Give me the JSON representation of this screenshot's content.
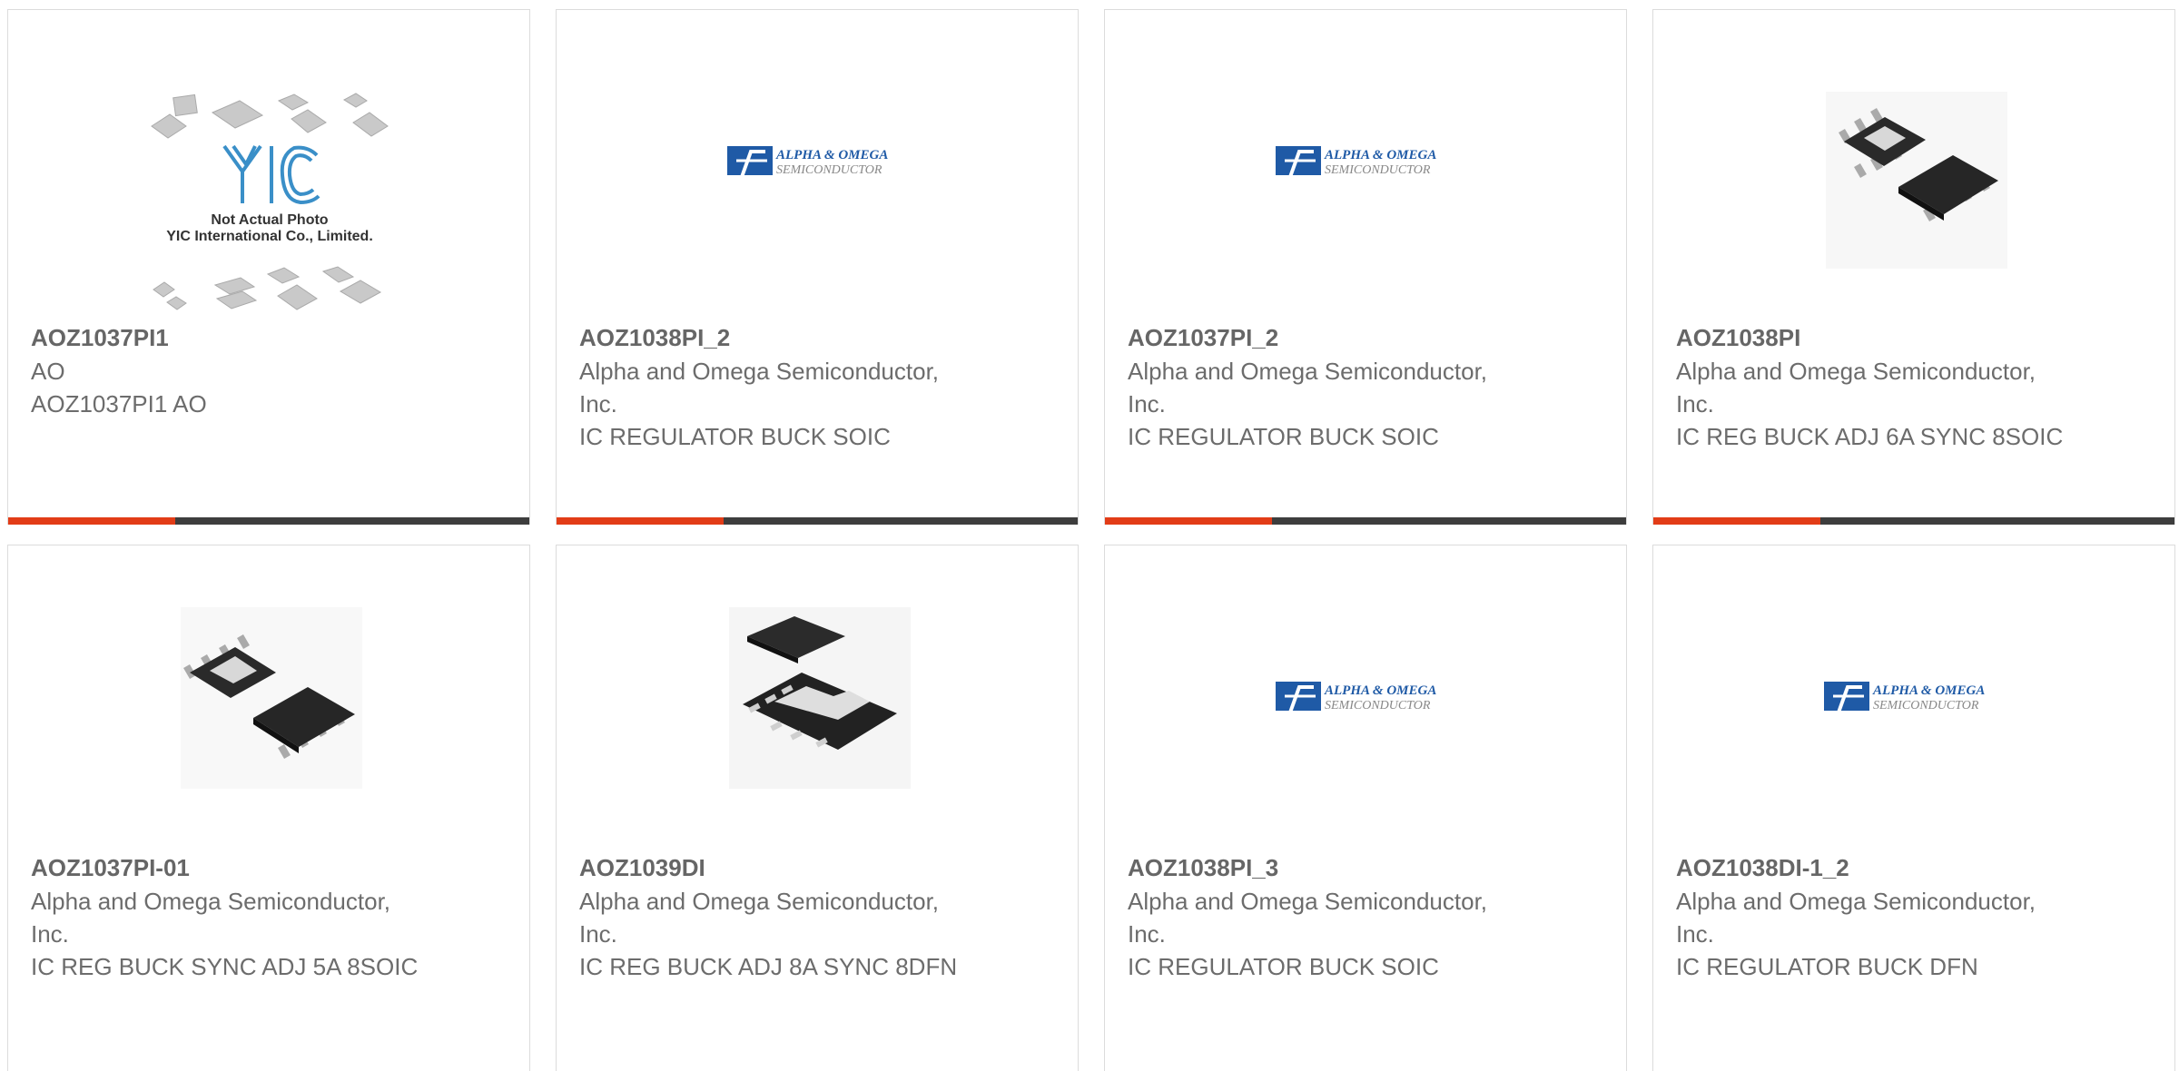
{
  "products": [
    {
      "part": "AOZ1037PI1",
      "mfr": "AO",
      "desc": "AOZ1037PI1 AO",
      "image": "not-actual-photo"
    },
    {
      "part": "AOZ1038PI_2",
      "mfr": "Alpha and Omega Semiconductor, Inc.",
      "desc": "IC REGULATOR BUCK SOIC",
      "image": "ao-logo"
    },
    {
      "part": "AOZ1037PI_2",
      "mfr": "Alpha and Omega Semiconductor, Inc.",
      "desc": "IC REGULATOR BUCK SOIC",
      "image": "ao-logo"
    },
    {
      "part": "AOZ1038PI",
      "mfr": "Alpha and Omega Semiconductor, Inc.",
      "desc": "IC REG BUCK ADJ 6A SYNC 8SOIC",
      "image": "soic8-photo"
    },
    {
      "part": "AOZ1037PI-01",
      "mfr": "Alpha and Omega Semiconductor, Inc.",
      "desc": "IC REG BUCK SYNC ADJ 5A 8SOIC",
      "image": "soic8-photo"
    },
    {
      "part": "AOZ1039DI",
      "mfr": "Alpha and Omega Semiconductor, Inc.",
      "desc": "IC REG BUCK ADJ 8A SYNC 8DFN",
      "image": "dfn8-photo"
    },
    {
      "part": "AOZ1038PI_3",
      "mfr": "Alpha and Omega Semiconductor, Inc.",
      "desc": "IC REGULATOR BUCK SOIC",
      "image": "ao-logo"
    },
    {
      "part": "AOZ1038DI-1_2",
      "mfr": "Alpha and Omega Semiconductor, Inc.",
      "desc": "IC REGULATOR BUCK DFN",
      "image": "ao-logo"
    }
  ],
  "placeholder_text": {
    "line1": "Not Actual Photo",
    "line2": "YIC International Co., Limited.",
    "brand": "YIC"
  },
  "logo_text": {
    "line1": "ALPHA & OMEGA",
    "line2": "SEMICONDUCTOR"
  },
  "colors": {
    "accent": "#e23c17",
    "bar": "#3d3d3d",
    "brand_blue": "#1f5aa6"
  }
}
